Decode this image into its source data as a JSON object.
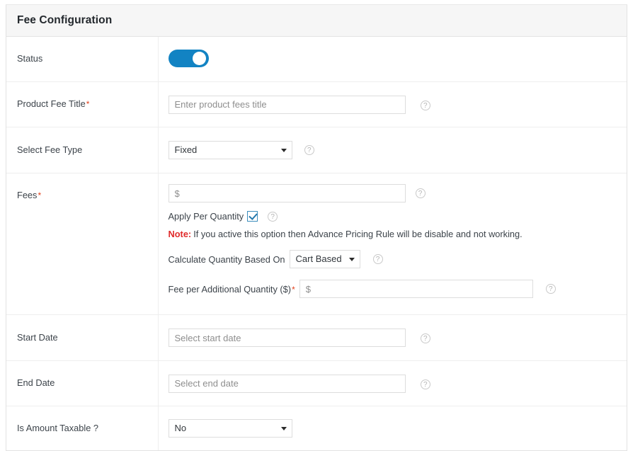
{
  "panel": {
    "title": "Fee Configuration"
  },
  "icons": {
    "help": "?",
    "help_name": "help-icon"
  },
  "rows": {
    "status": {
      "label": "Status",
      "toggle_on": true
    },
    "product_fee_title": {
      "label": "Product Fee Title",
      "required_marker": "*",
      "placeholder": "Enter product fees title",
      "value": ""
    },
    "select_fee_type": {
      "label": "Select Fee Type",
      "selected": "Fixed",
      "options": [
        "Fixed"
      ]
    },
    "fees": {
      "label": "Fees",
      "required_marker": "*",
      "placeholder": "$",
      "value": "",
      "apply_per_quantity": {
        "label": "Apply Per Quantity",
        "checked": true
      },
      "note": {
        "prefix": "Note:",
        "text": "If you active this option then Advance Pricing Rule will be disable and not working."
      },
      "calculate_quantity_based_on": {
        "label": "Calculate Quantity Based On",
        "selected": "Cart Based",
        "options": [
          "Cart Based"
        ]
      },
      "fee_per_additional_quantity": {
        "label": "Fee per Additional Quantity ($)",
        "required_marker": "*",
        "placeholder": "$",
        "value": ""
      }
    },
    "start_date": {
      "label": "Start Date",
      "placeholder": "Select start date",
      "value": ""
    },
    "end_date": {
      "label": "End Date",
      "placeholder": "Select end date",
      "value": ""
    },
    "is_amount_taxable": {
      "label": "Is Amount Taxable ?",
      "selected": "No",
      "options": [
        "No"
      ]
    }
  },
  "colors": {
    "accent": "#1283c3",
    "required": "#e2401c",
    "note": "#e02b2b",
    "header_bg": "#f6f6f6",
    "border": "#eeeeee"
  }
}
